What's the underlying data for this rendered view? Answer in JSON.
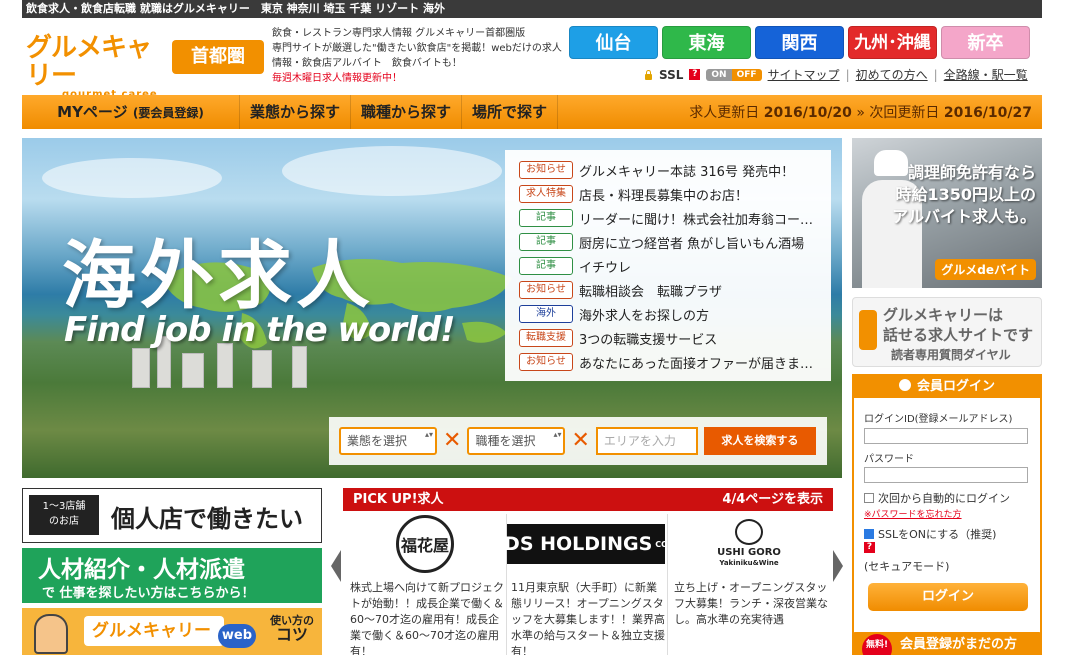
{
  "topbar": {
    "text": "飲食求人・飲食店転職 就職はグルメキャリー　東京 神奈川 埼玉 千葉 リゾート 海外"
  },
  "logo": {
    "jp": "グルメキャリー",
    "en": "gourmet caree",
    "area": "首都圏"
  },
  "intro": {
    "line1": "飲食・レストラン専門求人情報 グルメキャリー首都圏版",
    "line2": "専門サイトが厳選した\"働きたい飲食店\"を掲載！webだけの求人",
    "line3": "情報・飲食店アルバイト　飲食バイトも！",
    "line4": "毎週木曜日求人情報更新中！"
  },
  "regions": {
    "sendai": "仙台",
    "tokai": "東海",
    "kansai": "関西",
    "kyushu": "九州･沖縄",
    "shinsotsu": "新卒"
  },
  "util": {
    "ssl": "SSL",
    "on": "ON",
    "off": "OFF",
    "sitemap": "サイトマップ",
    "beginners": "初めての方へ",
    "lines": "全路線・駅一覧",
    "sep": "|"
  },
  "nav": {
    "mypage": "MYページ",
    "mypage_note": "(要会員登録)",
    "by_type": "業態から探す",
    "by_job": "職種から探す",
    "by_place": "場所で探す",
    "updated_label": "求人更新日",
    "updated": "2016/10/20",
    "arrow": "»",
    "next_label": "次回更新日",
    "next": "2016/10/27"
  },
  "hero": {
    "title": "海外求人",
    "subtitle": "Find job in the world!",
    "news": [
      {
        "tag": "お知らせ",
        "style": "red",
        "text": "グルメキャリー本誌 316号 発売中！"
      },
      {
        "tag": "求人特集",
        "style": "red",
        "text": "店長・料理長募集中のお店！"
      },
      {
        "tag": "記事",
        "style": "green",
        "text": "リーダーに聞け！株式会社加寿翁コー…"
      },
      {
        "tag": "記事",
        "style": "green",
        "text": "厨房に立つ経営者 魚がし旨いもん酒場"
      },
      {
        "tag": "記事",
        "style": "green",
        "text": "イチウレ"
      },
      {
        "tag": "お知らせ",
        "style": "red",
        "text": "転職相談会　転職プラザ"
      },
      {
        "tag": "海外",
        "style": "blue",
        "text": "海外求人をお探しの方"
      },
      {
        "tag": "転職支援",
        "style": "red",
        "text": "3つの転職支援サービス"
      },
      {
        "tag": "お知らせ",
        "style": "red",
        "text": "あなたにあった面接オファーが届きま…"
      }
    ],
    "search": {
      "type_select": "業態を選択",
      "job_select": "職種を選択",
      "times": "✕",
      "area_placeholder": "エリアを入力",
      "submit": "求人を検索する"
    }
  },
  "right": {
    "ad1": {
      "line1": "調理師免許有なら",
      "line2": "時給1350円以上の",
      "line3": "アルバイト求人も。",
      "logo": "グルメdeバイト"
    },
    "ad2": {
      "line1": "グルメキャリーは",
      "line2": "話せる求人サイトです",
      "line3": "読者専用質問ダイヤル"
    },
    "login": {
      "title": "会員ログイン",
      "id_label": "ログインID(登録メールアドレス)",
      "pw_label": "パスワード",
      "auto_login": "次回から自動的にログイン",
      "forgot": "※パスワードを忘れた方",
      "ssl_on": "SSLをONにする（推奨)",
      "secure_mode": "(セキュアモード)",
      "submit": "ログイン"
    },
    "register": {
      "free": "無料!",
      "text": "会員登録がまだの方"
    }
  },
  "banners": {
    "b1": {
      "tag1": "1〜3店舗",
      "tag2": "のお店",
      "text": "個人店で働きたい"
    },
    "b2": {
      "line1": "人材紹介・人材派遣",
      "line2": "で 仕事を探したい方はこちらから！"
    },
    "b3": {
      "logo": "グルメキャリー",
      "web": "web",
      "tips1": "使い方の",
      "tips2": "コツ"
    }
  },
  "pickup": {
    "title": "PICK UP!求人",
    "pages": "4/4ページを表示",
    "cards": [
      {
        "logo": "福花屋",
        "desc": "株式上場へ向けて新プロジェクトが始動！！成長企業で働く＆60〜70才迄の雇用有！成長企業で働く＆60〜70才迄の雇用有！"
      },
      {
        "logo": "KIDS HOLDINGS",
        "logo_sub": "CO.,LTD",
        "desc": "11月東京駅（大手町）に新業態リリース！オープニングスタッフを大募集します！！業界高水準の給与スタート＆独立支援有！"
      },
      {
        "logo": "USHI GORO",
        "logo_sub": "Yakiniku&Wine",
        "desc": "立ち上げ・オープニングスタッフ大募集！ランチ・深夜営業なし。高水準の充実待遇"
      }
    ]
  }
}
